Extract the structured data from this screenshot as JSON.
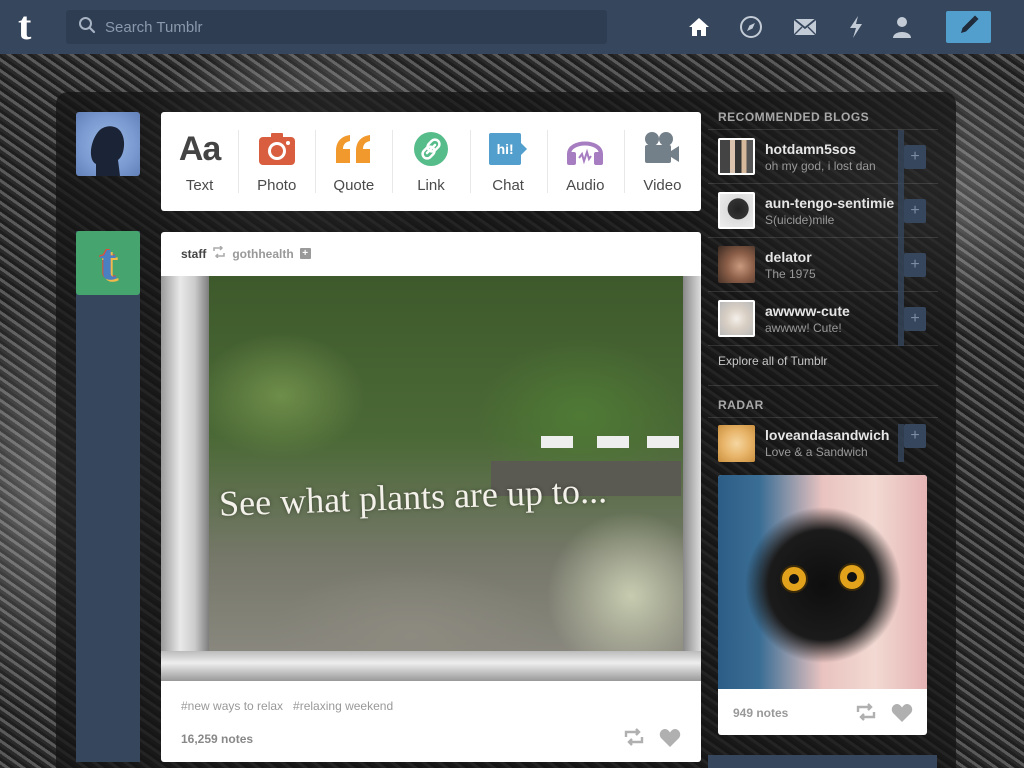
{
  "header": {
    "logo_letter": "t",
    "search_placeholder": "Search Tumblr",
    "nav_icons": [
      "home-icon",
      "explore-compass-icon",
      "inbox-envelope-icon",
      "activity-lightning-icon",
      "account-person-icon"
    ],
    "compose_icon": "pencil-icon"
  },
  "colors": {
    "topbar": "#36465d",
    "compose_button": "#529ecc",
    "text_icon": "#444444",
    "photo_icon": "#d95e40",
    "quote_icon": "#f2992e",
    "link_icon": "#56bc8a",
    "chat_icon": "#529ecc",
    "audio_icon": "#a77dc2",
    "video_icon": "#748089"
  },
  "post_types": [
    {
      "label": "Text",
      "icon": "text-aa-icon",
      "glyph": "Aa"
    },
    {
      "label": "Photo",
      "icon": "camera-icon"
    },
    {
      "label": "Quote",
      "icon": "quote-marks-icon",
      "glyph": "“"
    },
    {
      "label": "Link",
      "icon": "link-chain-icon"
    },
    {
      "label": "Chat",
      "icon": "chat-bubble-icon",
      "glyph": "hi!"
    },
    {
      "label": "Audio",
      "icon": "headphones-icon"
    },
    {
      "label": "Video",
      "icon": "video-camera-icon"
    }
  ],
  "post": {
    "author": "staff",
    "reblogged_from": "gothhealth",
    "image_caption": "See what plants are up to...",
    "tags": [
      "#new ways to relax",
      "#relaxing weekend"
    ],
    "notes": "16,259 notes"
  },
  "sidebar": {
    "recommended_title": "RECOMMENDED BLOGS",
    "blogs": [
      {
        "name": "hotdamn5sos",
        "subtitle": "oh my god, i lost dan"
      },
      {
        "name": "aun-tengo-sentimie",
        "subtitle": "S(uicide)mile"
      },
      {
        "name": "delator",
        "subtitle": "The 1975"
      },
      {
        "name": "awwww-cute",
        "subtitle": "awwww! Cute!"
      }
    ],
    "explore_link": "Explore all of Tumblr",
    "radar_title": "RADAR",
    "radar_blog": {
      "name": "loveandasandwich",
      "subtitle": "Love & a Sandwich"
    },
    "radar_notes": "949 notes"
  }
}
